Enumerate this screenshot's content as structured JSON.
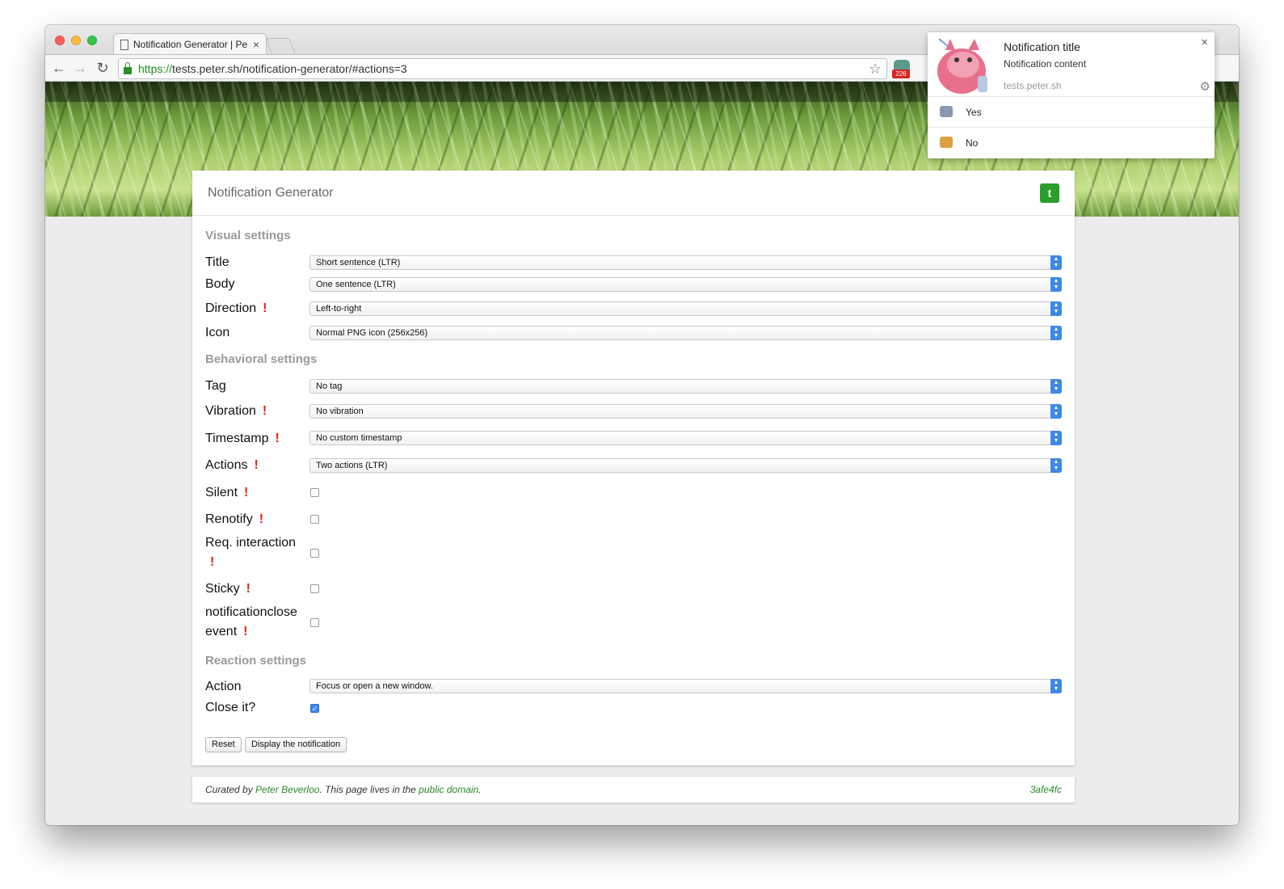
{
  "browser": {
    "tab_title": "Notification Generator | Pe",
    "url_scheme": "https://",
    "url_rest": "tests.peter.sh/notification-generator/#actions=3",
    "ext_badge": "226"
  },
  "card": {
    "title": "Notification Generator",
    "twitter_icon": "t"
  },
  "sections": {
    "visual": "Visual settings",
    "behavioral": "Behavioral settings",
    "reaction": "Reaction settings"
  },
  "fields": {
    "title": {
      "label": "Title",
      "value": "Short sentence (LTR)"
    },
    "body": {
      "label": "Body",
      "value": "One sentence (LTR)"
    },
    "direction": {
      "label": "Direction",
      "value": "Left-to-right"
    },
    "icon": {
      "label": "Icon",
      "value": "Normal PNG icon (256x256)"
    },
    "tag": {
      "label": "Tag",
      "value": "No tag"
    },
    "vibration": {
      "label": "Vibration",
      "value": "No vibration"
    },
    "timestamp": {
      "label": "Timestamp",
      "value": "No custom timestamp"
    },
    "actions": {
      "label": "Actions",
      "value": "Two actions (LTR)"
    },
    "silent": {
      "label": "Silent"
    },
    "renotify": {
      "label": "Renotify"
    },
    "req_interaction": {
      "label": "Req. interaction"
    },
    "sticky": {
      "label": "Sticky"
    },
    "nclose_1": {
      "label": "notificationclose"
    },
    "nclose_2": {
      "label": "event"
    },
    "action": {
      "label": "Action",
      "value": "Focus or open a new window."
    },
    "close_it": {
      "label": "Close it?"
    }
  },
  "bang": "!",
  "buttons": {
    "reset": "Reset",
    "display": "Display the notification"
  },
  "footer": {
    "curated_by": "Curated by ",
    "author": "Peter Beverloo",
    "mid": ". This page lives in the ",
    "domain": "public domain",
    "end": ".",
    "hash": "3afe4fc"
  },
  "notification": {
    "title": "Notification title",
    "body": "Notification content",
    "origin": "tests.peter.sh",
    "close": "×",
    "gear": "⚙",
    "actions": [
      {
        "label": "Yes"
      },
      {
        "label": "No"
      }
    ]
  },
  "colors": {
    "accent_green": "#2a8a2a",
    "warning_red": "#e0241b",
    "select_blue": "#3d88e8"
  }
}
